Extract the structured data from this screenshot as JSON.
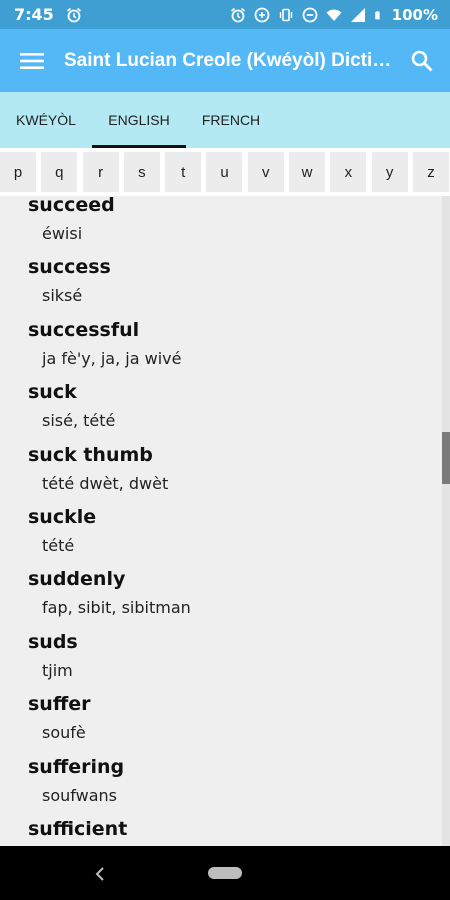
{
  "status_bar": {
    "time": "7:45",
    "battery": "100%"
  },
  "app_bar": {
    "title": "Saint Lucian Creole (Kwéyòl) Dictionary"
  },
  "tabs": [
    {
      "label": "KWÉYÒL",
      "active": false
    },
    {
      "label": "ENGLISH",
      "active": true
    },
    {
      "label": "FRENCH",
      "active": false
    }
  ],
  "letters": [
    "p",
    "q",
    "r",
    "s",
    "t",
    "u",
    "v",
    "w",
    "x",
    "y",
    "z"
  ],
  "entries": [
    {
      "term": "succeed",
      "translation": "éwisi"
    },
    {
      "term": "success",
      "translation": "siksé"
    },
    {
      "term": "successful",
      "translation": "ja fè'y, ja, ja wivé"
    },
    {
      "term": "suck",
      "translation": "sisé, tété"
    },
    {
      "term": "suck thumb",
      "translation": "tété dwèt, dwèt"
    },
    {
      "term": "suckle",
      "translation": "tété"
    },
    {
      "term": "suddenly",
      "translation": "fap, sibit, sibitman"
    },
    {
      "term": "suds",
      "translation": "tjim"
    },
    {
      "term": "suffer",
      "translation": "soufè"
    },
    {
      "term": "suffering",
      "translation": "soufwans"
    },
    {
      "term": "sufficient",
      "translation": ""
    }
  ],
  "colors": {
    "status_bar": "#3f9fd3",
    "app_bar": "#53b8f5",
    "tabs": "#b3e9f2"
  }
}
